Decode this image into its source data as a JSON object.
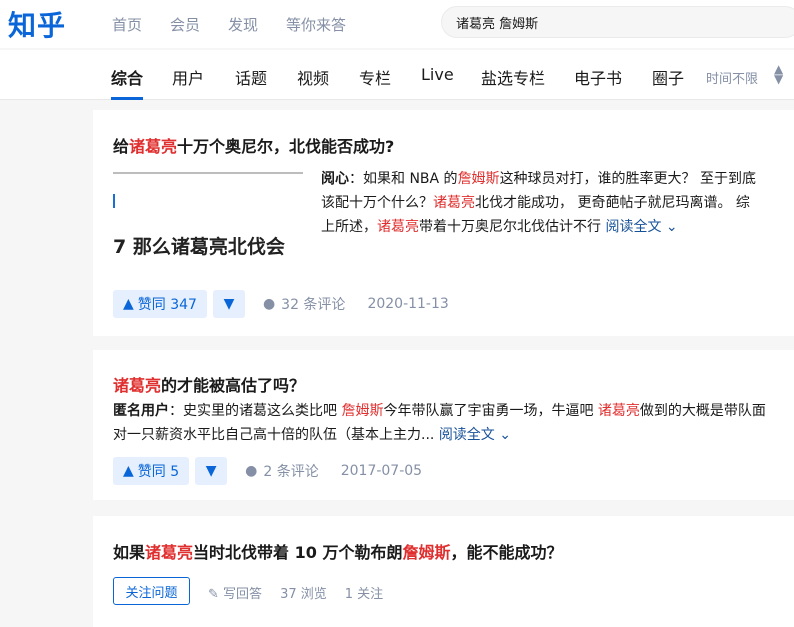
{
  "app": {
    "logo": "知乎"
  },
  "nav": [
    "首页",
    "会员",
    "发现",
    "等你来答"
  ],
  "search": {
    "value": "诸葛亮 詹姆斯"
  },
  "tabs": [
    "综合",
    "用户",
    "话题",
    "视频",
    "专栏",
    "Live",
    "盐选专栏",
    "电子书",
    "圈子"
  ],
  "active_tab": "综合",
  "time_filter": "时间不限",
  "results": [
    {
      "title_pre": "给",
      "title_hl": "诸葛亮",
      "title_post": "十万个奥尼尔，北伐能否成功?",
      "thumb_text": "7 那么诸葛亮北伐会",
      "author": "阅心",
      "ex1": "：如果和 NBA 的",
      "ex_hl1": "詹姆斯",
      "ex2": "这种球员对打，谁的胜率更大？ 至于到底该配十万个什么？",
      "ex_hl2": "诸葛亮",
      "ex3": "北伐才能成功，  更奇葩帖子就尼玛离谱。 综上所述，",
      "ex_hl3": "诸葛亮",
      "ex4": "带着十万奥尼尔北伐估计不行",
      "readmore": "阅读全文",
      "votes": "赞同 347",
      "comments": "32 条评论",
      "date": "2020-11-13"
    },
    {
      "title_hl": "诸葛亮",
      "title_post": "的才能被高估了吗？",
      "author": "匿名用户",
      "ex1": "：史实里的诸葛这么类比吧 ",
      "ex_hl1": "詹姆斯",
      "ex2": "今年带队赢了宇宙勇一场，牛逼吧 ",
      "ex_hl2": "诸葛亮",
      "ex3": "做到的大概是带队面对一只薪资水平比自己高十倍的队伍（基本上主力...",
      "readmore": "阅读全文",
      "votes": "赞同 5",
      "comments": "2 条评论",
      "date": "2017-07-05"
    },
    {
      "title_pre": "如果",
      "title_hl": "诸葛亮",
      "title_mid": "当时北伐带着 10 万个勒布朗",
      "title_hl2": "詹姆斯",
      "title_post": "，能不能成功？",
      "follow": "关注问题",
      "write": "写回答",
      "views": "37 浏览",
      "followers": "1 关注"
    }
  ]
}
